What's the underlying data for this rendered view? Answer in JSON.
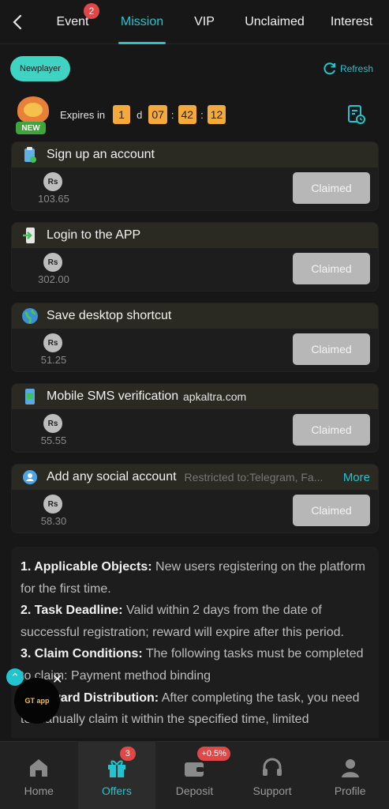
{
  "tabs": [
    {
      "label": "Event",
      "badge": "2"
    },
    {
      "label": "Mission"
    },
    {
      "label": "VIP"
    },
    {
      "label": "Unclaimed"
    },
    {
      "label": "Interest"
    }
  ],
  "chip_label": "Newplayer",
  "refresh_label": "Refresh",
  "expire": {
    "mascot_badge": "NEW",
    "label": "Expires in",
    "days": "1",
    "day_unit": "d",
    "hours": "07",
    "minutes": "42",
    "seconds": "12",
    "colon": ":"
  },
  "currency_symbol": "Rs",
  "tasks": [
    {
      "title": "Sign up an account",
      "amount": "103.65",
      "button": "Claimed"
    },
    {
      "title": "Login to the APP",
      "amount": "302.00",
      "button": "Claimed"
    },
    {
      "title": "Save desktop shortcut",
      "amount": "51.25",
      "button": "Claimed"
    },
    {
      "title": "Mobile SMS verification",
      "amount": "55.55",
      "button": "Claimed"
    },
    {
      "title": "Add any social account",
      "note": "Restricted to:Telegram, Fa...",
      "more": "More",
      "amount": "58.30",
      "button": "Claimed"
    }
  ],
  "watermark": "apkaltra.com",
  "rules": [
    {
      "heading": "1. Applicable Objects:",
      "text": " New users registering on the platform for the first time."
    },
    {
      "heading": "2. Task Deadline:",
      "text": " Valid within 2 days from the date of successful registration; reward will expire after this period."
    },
    {
      "heading": "3. Claim Conditions:",
      "text": " The following tasks must be completed to claim: Payment method binding"
    },
    {
      "heading": "4. Reward Distribution:",
      "text": " After completing the task, you need to manually claim it within the specified time, limited"
    }
  ],
  "float": {
    "up": "⌃",
    "close": "✕",
    "logo": "GT app"
  },
  "nav": [
    {
      "label": "Home"
    },
    {
      "label": "Offers",
      "badge": "3"
    },
    {
      "label": "Deposit",
      "badge": "+0.5%"
    },
    {
      "label": "Support"
    },
    {
      "label": "Profile"
    }
  ],
  "colors": {
    "accent": "#22c5cf",
    "badge": "#e04848",
    "timer": "#f4a93b",
    "claimed": "#b7b7b7",
    "background": "#171717"
  },
  "icons": [
    "back-arrow-icon",
    "refresh-icon",
    "document-clock-icon",
    "clipboard-icon",
    "phone-login-icon",
    "globe-icon",
    "sms-icon",
    "social-icon",
    "rupee-coin-icon",
    "home-icon",
    "gift-icon",
    "wallet-icon",
    "headset-icon",
    "profile-icon"
  ]
}
